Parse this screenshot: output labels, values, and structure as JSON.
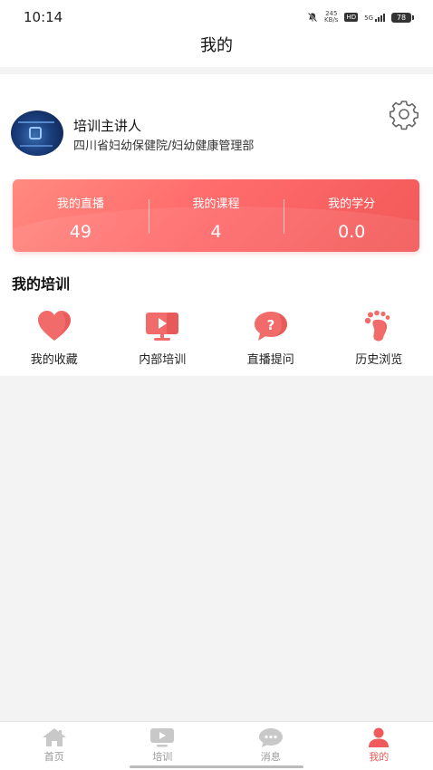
{
  "status_bar": {
    "time": "10:14",
    "net_speed_value": "245",
    "net_speed_unit": "KB/s",
    "hd": "HD",
    "network": "5G",
    "battery": "78"
  },
  "header": {
    "title": "我的"
  },
  "profile": {
    "name": "培训主讲人",
    "organization": "四川省妇幼保健院/妇幼健康管理部",
    "settings_icon": "gear-icon"
  },
  "stats": [
    {
      "label": "我的直播",
      "value": "49"
    },
    {
      "label": "我的课程",
      "value": "4"
    },
    {
      "label": "我的学分",
      "value": "0.0"
    }
  ],
  "training": {
    "title": "我的培训",
    "items": [
      {
        "label": "我的收藏",
        "icon": "heart-icon"
      },
      {
        "label": "内部培训",
        "icon": "video-screen-icon"
      },
      {
        "label": "直播提问",
        "icon": "question-bubble-icon"
      },
      {
        "label": "历史浏览",
        "icon": "footprint-icon"
      }
    ]
  },
  "tabs": [
    {
      "label": "首页",
      "icon": "home-icon",
      "active": false
    },
    {
      "label": "培训",
      "icon": "video-screen-icon",
      "active": false
    },
    {
      "label": "消息",
      "icon": "chat-icon",
      "active": false
    },
    {
      "label": "我的",
      "icon": "person-icon",
      "active": true
    }
  ],
  "colors": {
    "accent": "#f05a5a",
    "card_gradient_start": "#ff8a80",
    "card_gradient_end": "#f25858",
    "inactive_tab": "#c8c8c8"
  }
}
